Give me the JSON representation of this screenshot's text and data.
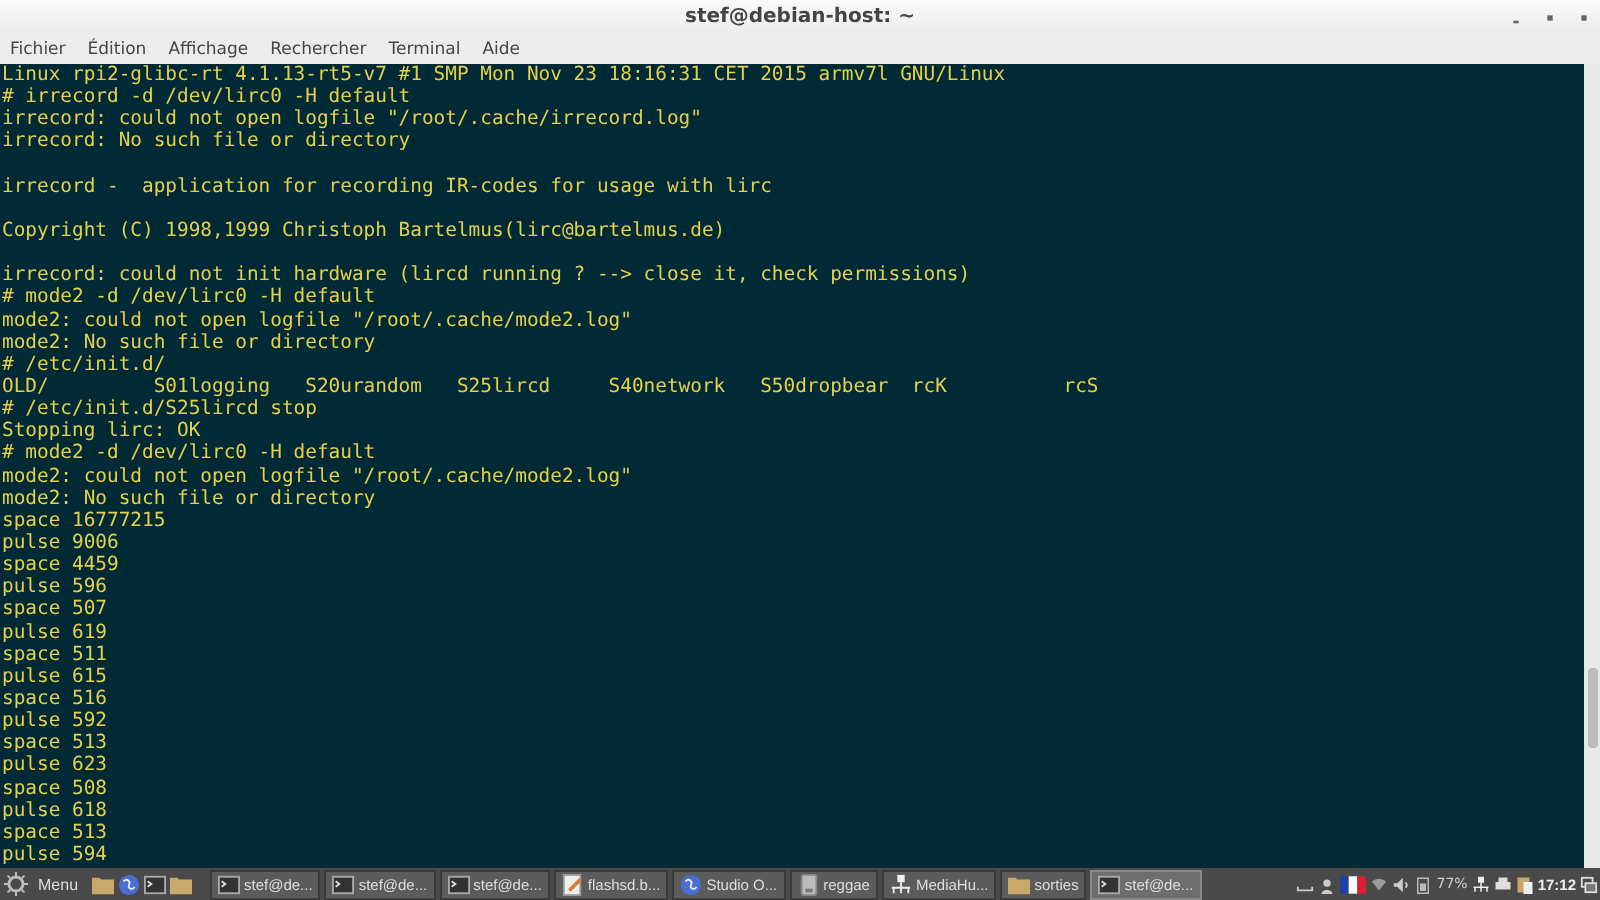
{
  "window": {
    "title": "stef@debian-host: ~"
  },
  "menu": [
    "Fichier",
    "Édition",
    "Affichage",
    "Rechercher",
    "Terminal",
    "Aide"
  ],
  "terminal": {
    "lines": [
      {
        "text": "Linux rpi2-glibc-rt 4.1.13-rt5-v7 #1 SMP Mon Nov 23 18:16:31 CET 2015 armv7l GNU/Linux"
      },
      {
        "text": "# irrecord -d /dev/lirc0 -H default"
      },
      {
        "text": "irrecord: could not open logfile \"/root/.cache/irrecord.log\""
      },
      {
        "text": "irrecord: No such file or directory"
      },
      {
        "kind": "blank"
      },
      {
        "text": "irrecord -  application for recording IR-codes for usage with lirc"
      },
      {
        "kind": "blank"
      },
      {
        "text": "Copyright (C) 1998,1999 Christoph Bartelmus(lirc@bartelmus.de)"
      },
      {
        "kind": "blank"
      },
      {
        "text": "irrecord: could not init hardware (lircd running ? --> close it, check permissions)"
      },
      {
        "text": "# mode2 -d /dev/lirc0 -H default"
      },
      {
        "text": "mode2: could not open logfile \"/root/.cache/mode2.log\""
      },
      {
        "text": "mode2: No such file or directory"
      },
      {
        "text": "# /etc/init.d/"
      },
      {
        "text": "OLD/         S01logging   S20urandom   S25lircd     S40network   S50dropbear  rcK          rcS"
      },
      {
        "text": "# /etc/init.d/S25lircd stop"
      },
      {
        "text": "Stopping lirc: OK"
      },
      {
        "text": "# mode2 -d /dev/lirc0 -H default"
      },
      {
        "text": "mode2: could not open logfile \"/root/.cache/mode2.log\""
      },
      {
        "text": "mode2: No such file or directory"
      },
      {
        "text": "space 16777215"
      },
      {
        "text": "pulse 9006"
      },
      {
        "text": "space 4459"
      },
      {
        "text": "pulse 596"
      },
      {
        "text": "space 507"
      },
      {
        "text": "pulse 619"
      },
      {
        "text": "space 511"
      },
      {
        "text": "pulse 615"
      },
      {
        "text": "space 516"
      },
      {
        "text": "pulse 592"
      },
      {
        "text": "space 513"
      },
      {
        "text": "pulse 623"
      },
      {
        "text": "space 508"
      },
      {
        "text": "pulse 618"
      },
      {
        "text": "space 513"
      },
      {
        "text": "pulse 594"
      }
    ]
  },
  "taskbar": {
    "menu_label": "Menu",
    "launchers": [
      {
        "kind": "folder"
      },
      {
        "kind": "globe"
      },
      {
        "kind": "terminal"
      },
      {
        "kind": "folder"
      }
    ],
    "tasks": [
      {
        "kind": "terminal",
        "label": "stef@de...",
        "selected": false
      },
      {
        "kind": "terminal",
        "label": "stef@de...",
        "selected": false
      },
      {
        "kind": "terminal",
        "label": "stef@de...",
        "selected": false
      },
      {
        "kind": "document",
        "label": "flashsd.b...",
        "selected": false
      },
      {
        "kind": "globe",
        "label": "Studio O...",
        "selected": false
      },
      {
        "kind": "drive",
        "label": "reggae",
        "selected": false
      },
      {
        "kind": "network",
        "label": "MediaHu...",
        "selected": false
      },
      {
        "kind": "folder",
        "label": "sorties",
        "selected": false
      },
      {
        "kind": "terminal",
        "label": "stef@de...",
        "selected": true
      }
    ],
    "battery": "77%",
    "clock": "17:12"
  }
}
